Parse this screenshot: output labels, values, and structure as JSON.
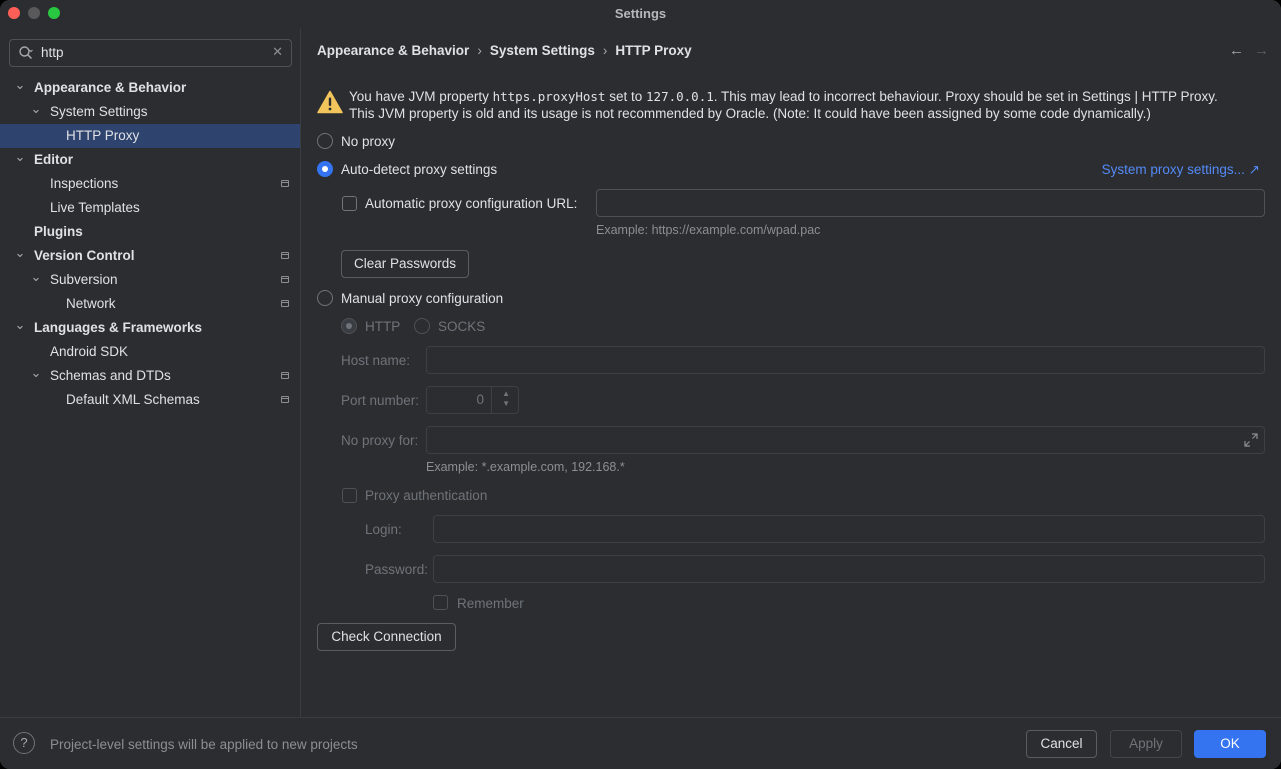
{
  "window": {
    "title": "Settings"
  },
  "search": {
    "value": "http"
  },
  "tree": [
    {
      "label": "Appearance & Behavior",
      "bold": true,
      "chevron": true,
      "indent": 0,
      "project": false
    },
    {
      "label": "System Settings",
      "bold": false,
      "chevron": true,
      "indent": 1,
      "project": false
    },
    {
      "label": "HTTP Proxy",
      "bold": false,
      "chevron": false,
      "indent": 2,
      "project": false,
      "selected": true
    },
    {
      "label": "Editor",
      "bold": true,
      "chevron": true,
      "indent": 0,
      "project": false
    },
    {
      "label": "Inspections",
      "bold": false,
      "chevron": false,
      "indent": 1,
      "project": true
    },
    {
      "label": "Live Templates",
      "bold": false,
      "chevron": false,
      "indent": 1,
      "project": false
    },
    {
      "label": "Plugins",
      "bold": true,
      "chevron": false,
      "indent": 0,
      "project": false
    },
    {
      "label": "Version Control",
      "bold": true,
      "chevron": true,
      "indent": 0,
      "project": true
    },
    {
      "label": "Subversion",
      "bold": false,
      "chevron": true,
      "indent": 1,
      "project": true
    },
    {
      "label": "Network",
      "bold": false,
      "chevron": false,
      "indent": 2,
      "project": true
    },
    {
      "label": "Languages & Frameworks",
      "bold": true,
      "chevron": true,
      "indent": 0,
      "project": false
    },
    {
      "label": "Android SDK",
      "bold": false,
      "chevron": false,
      "indent": 1,
      "project": false
    },
    {
      "label": "Schemas and DTDs",
      "bold": false,
      "chevron": true,
      "indent": 1,
      "project": true
    },
    {
      "label": "Default XML Schemas",
      "bold": false,
      "chevron": false,
      "indent": 2,
      "project": true
    }
  ],
  "breadcrumb": {
    "items": [
      "Appearance & Behavior",
      "System Settings",
      "HTTP Proxy"
    ],
    "separator": "›"
  },
  "nav": {
    "back": "←",
    "forward": "→"
  },
  "warning": {
    "part1": "You have JVM property ",
    "property": "https.proxyHost",
    "part2": " set to ",
    "value": "127.0.0.1",
    "part3": ". This may lead to incorrect behaviour. Proxy should be set in Settings | HTTP Proxy.",
    "line2": "This JVM property is old and its usage is not recommended by Oracle. (Note: It could have been assigned by some code dynamically.)"
  },
  "proxy": {
    "no_proxy": "No proxy",
    "auto_detect": "Auto-detect proxy settings",
    "system_settings_link": "System proxy settings... ↗",
    "auto_url_label": "Automatic proxy configuration URL:",
    "auto_url_value": "",
    "auto_url_hint": "Example: https://example.com/wpad.pac",
    "clear_passwords": "Clear Passwords",
    "manual": "Manual proxy configuration",
    "http": "HTTP",
    "socks": "SOCKS",
    "host_label": "Host name:",
    "host_value": "",
    "port_label": "Port number:",
    "port_value": "0",
    "no_proxy_for_label": "No proxy for:",
    "no_proxy_for_hint": "Example: *.example.com, 192.168.*",
    "proxy_auth": "Proxy authentication",
    "login_label": "Login:",
    "password_label": "Password:",
    "remember": "Remember",
    "check_connection": "Check Connection",
    "selected_mode": "auto-detect"
  },
  "footer": {
    "help": "?",
    "note": "Project-level settings will be applied to new projects",
    "cancel": "Cancel",
    "apply": "Apply",
    "ok": "OK"
  },
  "colors": {
    "accent": "#3574f0",
    "selection": "#2e436e",
    "link": "#548af7",
    "warning": "#f2c55c"
  }
}
